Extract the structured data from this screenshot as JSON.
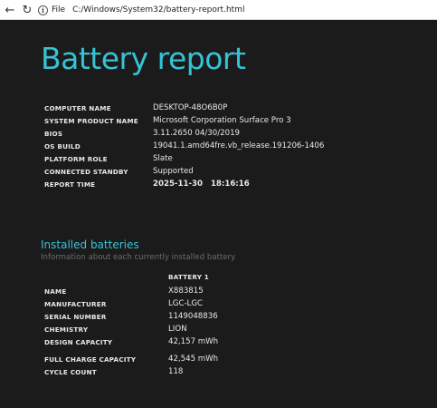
{
  "browser": {
    "scheme": "File",
    "url": "C:/Windows/System32/battery-report.html"
  },
  "report": {
    "title": "Battery report",
    "system": [
      {
        "key": "COMPUTER NAME",
        "value": "DESKTOP-48O6B0P"
      },
      {
        "key": "SYSTEM PRODUCT NAME",
        "value": "Microsoft Corporation Surface Pro 3"
      },
      {
        "key": "BIOS",
        "value": "3.11.2650 04/30/2019"
      },
      {
        "key": "OS BUILD",
        "value": "19041.1.amd64fre.vb_release.191206-1406"
      },
      {
        "key": "PLATFORM ROLE",
        "value": "Slate"
      },
      {
        "key": "CONNECTED STANDBY",
        "value": "Supported"
      },
      {
        "key": "REPORT TIME",
        "value": "2025-11-30   18:16:16"
      }
    ]
  },
  "installed_batteries": {
    "heading": "Installed batteries",
    "subtitle": "Information about each currently installed battery",
    "column": "BATTERY 1",
    "rows": [
      {
        "key": "NAME",
        "value": "X883815"
      },
      {
        "key": "MANUFACTURER",
        "value": "LGC-LGC"
      },
      {
        "key": "SERIAL NUMBER",
        "value": "1149048836"
      },
      {
        "key": "CHEMISTRY",
        "value": "LION"
      },
      {
        "key": "DESIGN CAPACITY",
        "value": "42,157 mWh"
      },
      {
        "key": "FULL CHARGE CAPACITY",
        "value": "42,545 mWh"
      },
      {
        "key": "CYCLE COUNT",
        "value": "118"
      }
    ]
  }
}
